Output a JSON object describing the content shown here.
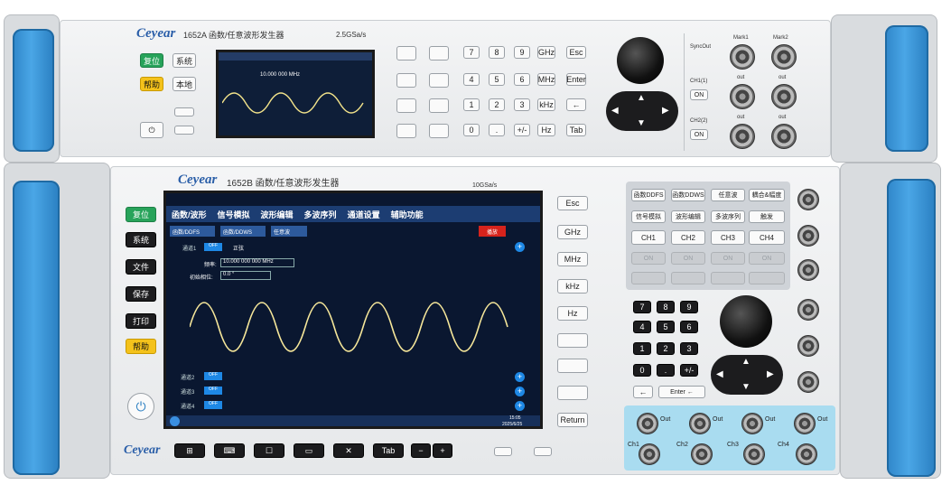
{
  "top_unit": {
    "brand": "Ceyear",
    "model": "1652A 函数/任意波形发生器",
    "rate": "2.5GSa/s",
    "left_buttons": [
      "复位",
      "系统",
      "帮助",
      "本地"
    ],
    "right_keys": [
      "Esc",
      "Enter",
      "Tab"
    ],
    "unit_keys": [
      "GHz",
      "MHz",
      "kHz",
      "Hz"
    ],
    "channel_labels": [
      "SyncOut",
      "Mark1",
      "Mark2",
      "CH1(1)",
      "out",
      "out",
      "CH2(2)",
      "out",
      "out"
    ],
    "on_label": "ON",
    "screen_freq": "10.000 000 MHz"
  },
  "bottom_unit": {
    "brand": "Ceyear",
    "model": "1652B 函数/任意波形发生器",
    "rate": "10GSa/s",
    "left_buttons": [
      "复位",
      "系统",
      "文件",
      "保存",
      "打印",
      "帮助"
    ],
    "screen": {
      "menu": [
        "函数/波形",
        "信号模拟",
        "波形编辑",
        "多波序列",
        "通道设置",
        "辅助功能"
      ],
      "tabs": [
        "函数/DDFS",
        "函数/DDWS",
        "任意波"
      ],
      "alert": "播放",
      "channel1": "通道1",
      "off": "OFF",
      "shape": "正弦",
      "freq_label": "频率:",
      "freq_value": "10.000 000 000 MHz",
      "phase_label": "初始相位:",
      "phase_value": "0.0 °",
      "channels": [
        "通道2",
        "通道3",
        "通道4"
      ],
      "clock": "15:05",
      "date": "2025/6/25"
    },
    "side_keys": [
      "Esc",
      "GHz",
      "MHz",
      "kHz",
      "Hz",
      "Return"
    ],
    "function_keys": [
      "函数DDFS",
      "函数DDWS",
      "任意波",
      "耦合&幅度",
      "信号模拟",
      "波形编辑",
      "多波序列",
      "触发"
    ],
    "ch_keys": [
      "CH1",
      "CH2",
      "CH3",
      "CH4"
    ],
    "on_label": "ON",
    "bottom_keys": [
      "Tab",
      "−",
      "+"
    ],
    "enter_label": "Enter ←",
    "out_labels": [
      "Ch1",
      "Ch2",
      "Ch3",
      "Ch4"
    ],
    "out_word": "Out"
  },
  "colors": {
    "handle": "#3a96d8",
    "green": "#27a35a",
    "yellow": "#f4c21b",
    "teal_panel": "#a9dcf0"
  }
}
